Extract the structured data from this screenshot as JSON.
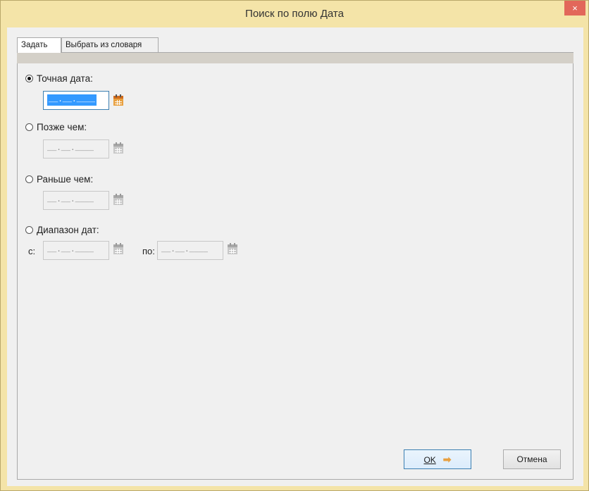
{
  "window": {
    "title": "Поиск по полю Дата",
    "close_glyph": "×",
    "title_color": "#f4e4a8"
  },
  "tabs": [
    {
      "label": "Задать",
      "active": true
    },
    {
      "label": "Выбрать из словаря",
      "active": false
    }
  ],
  "options": {
    "exact": {
      "label": "Точная дата:",
      "checked": true,
      "value": "__.__.____"
    },
    "after": {
      "label": "Позже чем:",
      "checked": false,
      "value": "__.__.____"
    },
    "before": {
      "label": "Раньше чем:",
      "checked": false,
      "value": "__.__.____"
    },
    "range": {
      "label": "Диапазон дат:",
      "checked": false,
      "from_label": "с:",
      "from_value": "__.__.____",
      "to_label": "по:",
      "to_value": "__.__.____"
    }
  },
  "icons": {
    "calendar_active": "calendar-icon",
    "calendar_disabled": "calendar-icon",
    "ok_arrow": "arrow-right-icon"
  },
  "buttons": {
    "ok_label": "OK",
    "ok_arrow": "➡",
    "cancel_label": "Отмена"
  },
  "colors": {
    "accent": "#3399ff",
    "calendar_active": "#e8a040",
    "calendar_disabled": "#c8c8c8"
  }
}
